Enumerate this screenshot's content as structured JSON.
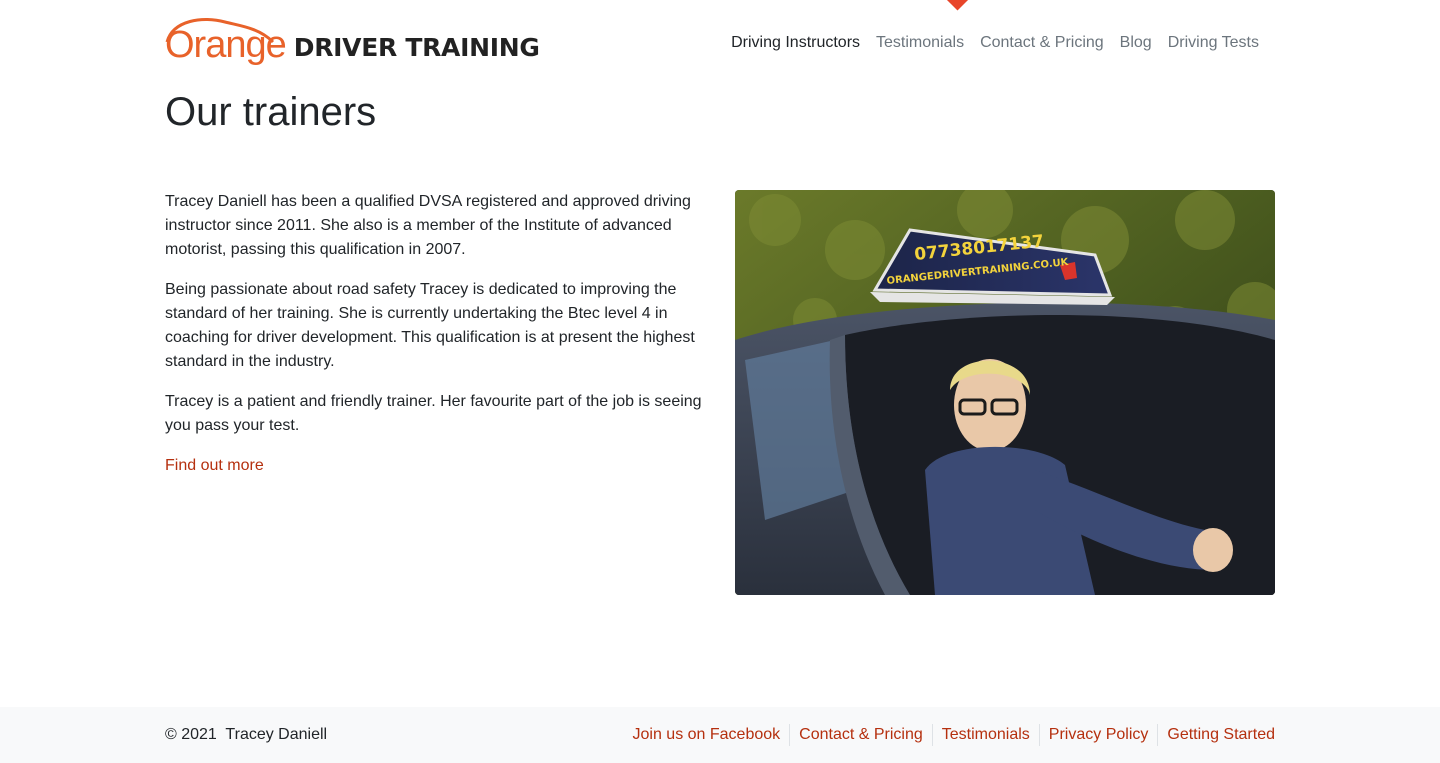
{
  "header": {
    "logo": {
      "word1": "Orange",
      "word2": "DRIVER TRAINING",
      "brand_color": "#e8622a"
    },
    "nav": [
      {
        "label": "Driving Instructors",
        "active": true
      },
      {
        "label": "Testimonials",
        "active": false
      },
      {
        "label": "Contact & Pricing",
        "active": false
      },
      {
        "label": "Blog",
        "active": false
      },
      {
        "label": "Driving Tests",
        "active": false
      }
    ],
    "active_marker_color": "#e8452a"
  },
  "main": {
    "title": "Our trainers",
    "paragraphs": [
      "Tracey Daniell has been a qualified DVSA registered and approved driving instructor since 2011. She also is a member of the Institute of advanced motorist, passing this qualification in 2007.",
      "Being passionate about road safety Tracey is dedicated to improving the standard of her training. She is currently undertaking the Btec level 4 in coaching for driver development. This qualification is at present the highest standard in the industry.",
      "Tracey is a patient and friendly trainer. Her favourite part of the job is seeing you pass your test."
    ],
    "link_label": "Find out more",
    "photo": {
      "roof_sign_phone": "07738017137",
      "roof_sign_url": "ORANGEDRIVERTRAINING.CO.UK"
    }
  },
  "footer": {
    "copyright": "© 2021  Tracey Daniell",
    "links": [
      "Join us on Facebook",
      "Contact & Pricing",
      "Testimonials",
      "Privacy Policy",
      "Getting Started"
    ],
    "link_color": "#b5300f"
  }
}
